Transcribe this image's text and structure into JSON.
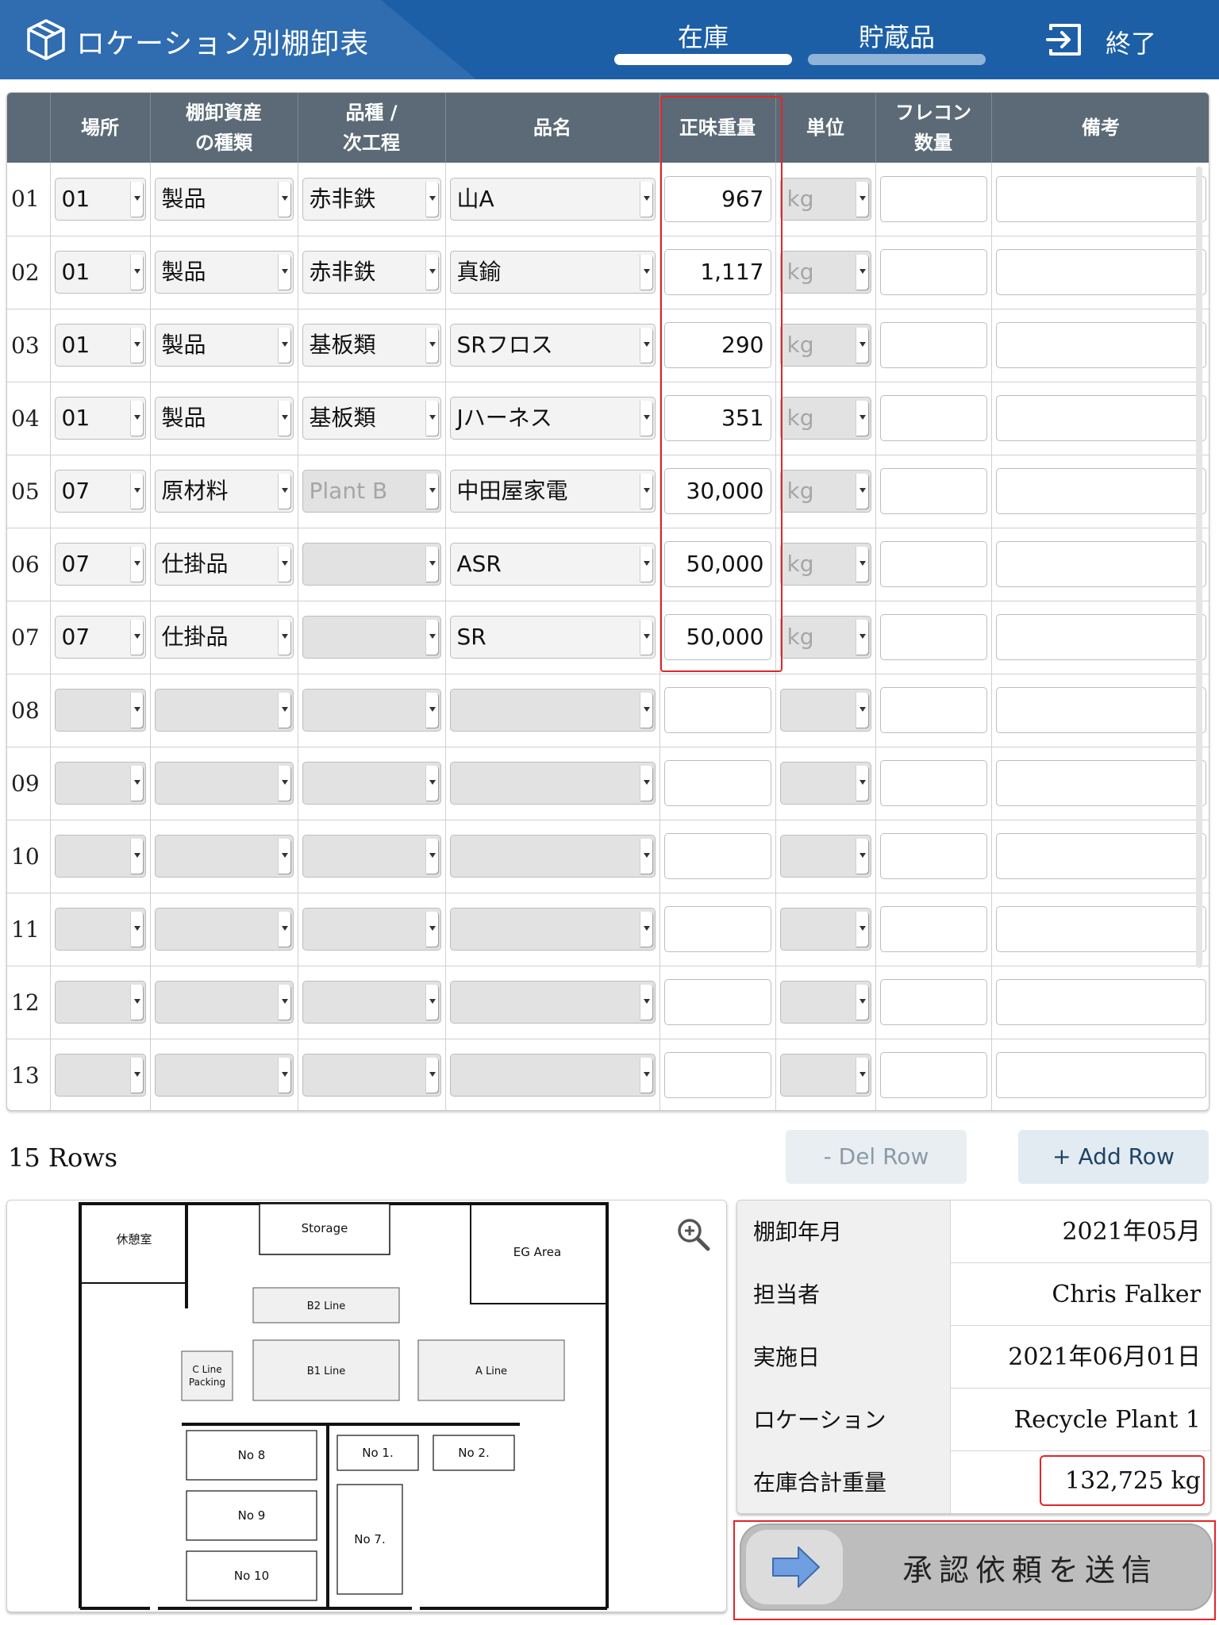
{
  "header": {
    "title": "ロケーション別棚卸表",
    "tabs": [
      {
        "label": "在庫",
        "active": true
      },
      {
        "label": "貯蔵品",
        "active": false
      }
    ],
    "exit_label": "終了",
    "colors": {
      "header_bg": "#1d5fa6",
      "active_tab": "#ffffff",
      "inactive_tab": "#8fb3d9",
      "highlight": "#e0262a"
    }
  },
  "table": {
    "headers": {
      "location": "場所",
      "asset_type_1": "棚卸資産",
      "asset_type_2": "の種類",
      "variety_1": "品種 /",
      "variety_2": "次工程",
      "item_name": "品名",
      "net_weight": "正味重量",
      "unit": "単位",
      "flecon_1": "フレコン",
      "flecon_2": "数量",
      "remarks": "備考"
    },
    "rows": [
      {
        "no": "01",
        "location": "01",
        "asset_type": "製品",
        "variety": "赤非鉄",
        "item": "山A",
        "weight": "967",
        "unit": "kg",
        "flecon": "",
        "remarks": ""
      },
      {
        "no": "02",
        "location": "01",
        "asset_type": "製品",
        "variety": "赤非鉄",
        "item": "真鍮",
        "weight": "1,117",
        "unit": "kg",
        "flecon": "",
        "remarks": ""
      },
      {
        "no": "03",
        "location": "01",
        "asset_type": "製品",
        "variety": "基板類",
        "item": "SRフロス",
        "weight": "290",
        "unit": "kg",
        "flecon": "",
        "remarks": ""
      },
      {
        "no": "04",
        "location": "01",
        "asset_type": "製品",
        "variety": "基板類",
        "item": "Jハーネス",
        "weight": "351",
        "unit": "kg",
        "flecon": "",
        "remarks": ""
      },
      {
        "no": "05",
        "location": "07",
        "asset_type": "原材料",
        "variety": "Plant B",
        "item": "中田屋家電",
        "weight": "30,000",
        "unit": "kg",
        "flecon": "",
        "remarks": ""
      },
      {
        "no": "06",
        "location": "07",
        "asset_type": "仕掛品",
        "variety": "",
        "item": "ASR",
        "weight": "50,000",
        "unit": "kg",
        "flecon": "",
        "remarks": ""
      },
      {
        "no": "07",
        "location": "07",
        "asset_type": "仕掛品",
        "variety": "",
        "item": "SR",
        "weight": "50,000",
        "unit": "kg",
        "flecon": "",
        "remarks": ""
      },
      {
        "no": "08",
        "location": "",
        "asset_type": "",
        "variety": "",
        "item": "",
        "weight": "",
        "unit": "",
        "flecon": "",
        "remarks": ""
      },
      {
        "no": "09",
        "location": "",
        "asset_type": "",
        "variety": "",
        "item": "",
        "weight": "",
        "unit": "",
        "flecon": "",
        "remarks": ""
      },
      {
        "no": "10",
        "location": "",
        "asset_type": "",
        "variety": "",
        "item": "",
        "weight": "",
        "unit": "",
        "flecon": "",
        "remarks": ""
      },
      {
        "no": "11",
        "location": "",
        "asset_type": "",
        "variety": "",
        "item": "",
        "weight": "",
        "unit": "",
        "flecon": "",
        "remarks": ""
      },
      {
        "no": "12",
        "location": "",
        "asset_type": "",
        "variety": "",
        "item": "",
        "weight": "",
        "unit": "",
        "flecon": "",
        "remarks": ""
      },
      {
        "no": "13",
        "location": "",
        "asset_type": "",
        "variety": "",
        "item": "",
        "weight": "",
        "unit": "",
        "flecon": "",
        "remarks": ""
      }
    ]
  },
  "footer": {
    "rows_count": "15 Rows",
    "del_row": "- Del Row",
    "add_row": "+ Add Row"
  },
  "floor_map": {
    "labels": {
      "rest_room": "休憩室",
      "storage": "Storage",
      "eg_area": "EG Area",
      "b2_line": "B2 Line",
      "b1_line": "B1 Line",
      "a_line": "A Line",
      "c_line_1": "C Line",
      "c_line_2": "Packing",
      "no8": "No 8",
      "no9": "No 9",
      "no10": "No 10",
      "no1": "No 1.",
      "no2": "No 2.",
      "no7": "No 7."
    }
  },
  "info": {
    "inventory_month_label": "棚卸年月",
    "inventory_month_value": "2021年05月",
    "person_label": "担当者",
    "person_value": "Chris Falker",
    "date_label": "実施日",
    "date_value": "2021年06月01日",
    "location_label": "ロケーション",
    "location_value": "Recycle Plant 1",
    "total_label": "在庫合計重量",
    "total_value": "132,725 kg"
  },
  "submit": {
    "label": "承認依頼を送信",
    "icon": "arrow-right-icon"
  }
}
